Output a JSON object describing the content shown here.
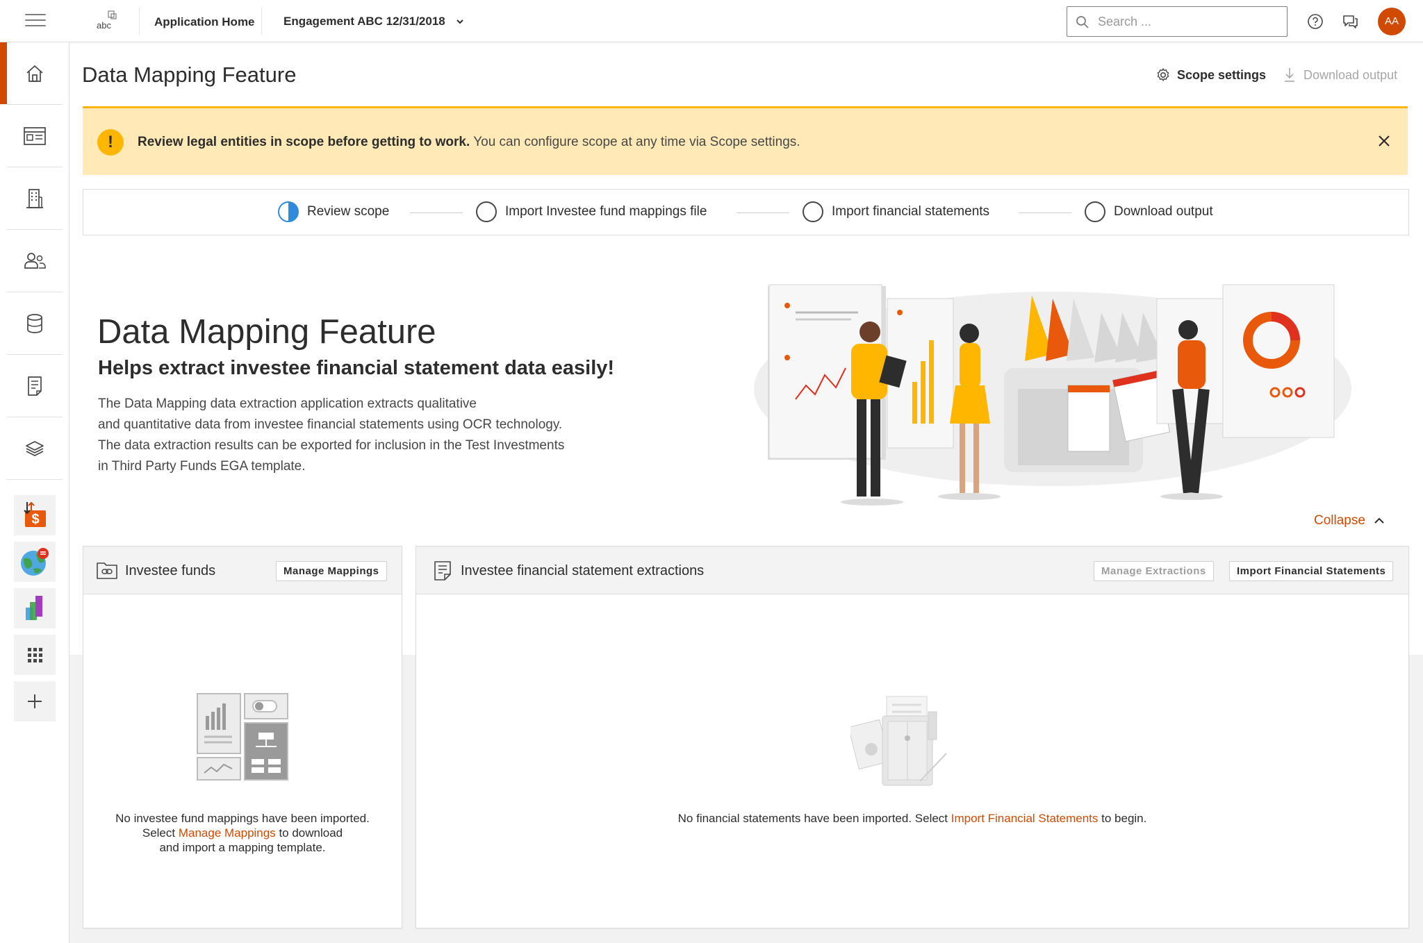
{
  "header": {
    "logo_text": "abc",
    "app_home": "Application Home",
    "engagement": "Engagement ABC 12/31/2018",
    "search_placeholder": "Search ...",
    "avatar_initials": "AA"
  },
  "sidebar": {
    "items": [
      {
        "icon": "home-icon",
        "active": true
      },
      {
        "icon": "dashboard-icon",
        "active": false
      },
      {
        "icon": "building-icon",
        "active": false
      },
      {
        "icon": "people-icon",
        "active": false
      },
      {
        "icon": "database-icon",
        "active": false
      },
      {
        "icon": "document-icon",
        "active": false
      },
      {
        "icon": "layers-icon",
        "active": false
      }
    ],
    "apps": [
      {
        "icon": "dollar-transfer-app-icon"
      },
      {
        "icon": "globe-app-icon"
      },
      {
        "icon": "chart-app-icon"
      },
      {
        "icon": "app-grid-icon"
      },
      {
        "icon": "add-icon"
      }
    ]
  },
  "page": {
    "title": "Data Mapping Feature",
    "scope_settings": "Scope settings",
    "download_output": "Download output"
  },
  "banner": {
    "bold": "Review legal entities in scope before getting to work.",
    "text": " You can configure scope at any time via Scope settings."
  },
  "steps": [
    {
      "label": "Review scope",
      "state": "in-progress"
    },
    {
      "label": "Import Investee fund mappings file",
      "state": "not-started"
    },
    {
      "label": "Import financial statements",
      "state": "not-started"
    },
    {
      "label": "Download output",
      "state": "not-started"
    }
  ],
  "hero": {
    "title": "Data Mapping Feature",
    "subtitle": "Helps extract investee financial statement data easily!",
    "body": [
      "The Data Mapping data extraction application extracts qualitative",
      "and quantitative data from investee financial statements using OCR technology.",
      "The data extraction results can be exported for inclusion in the Test Investments",
      "in Third Party Funds EGA template."
    ],
    "collapse": "Collapse"
  },
  "funds_card": {
    "title": "Investee funds",
    "button": "Manage Mappings",
    "empty_line1": "No investee fund mappings have been imported.",
    "empty_pre": "Select ",
    "empty_link": "Manage Mappings",
    "empty_post": " to download",
    "empty_line3": "and import a mapping template."
  },
  "extractions_card": {
    "title": "Investee financial statement extractions",
    "button_manage": "Manage Extractions",
    "button_import": "Import Financial Statements",
    "empty_pre": "No financial statements have been imported. Select ",
    "empty_link": "Import Financial Statements",
    "empty_post": " to begin."
  },
  "colors": {
    "brand": "#d04a02",
    "warning": "#ffb600",
    "banner_bg": "#ffeab7",
    "progress": "#2e8bdc"
  }
}
